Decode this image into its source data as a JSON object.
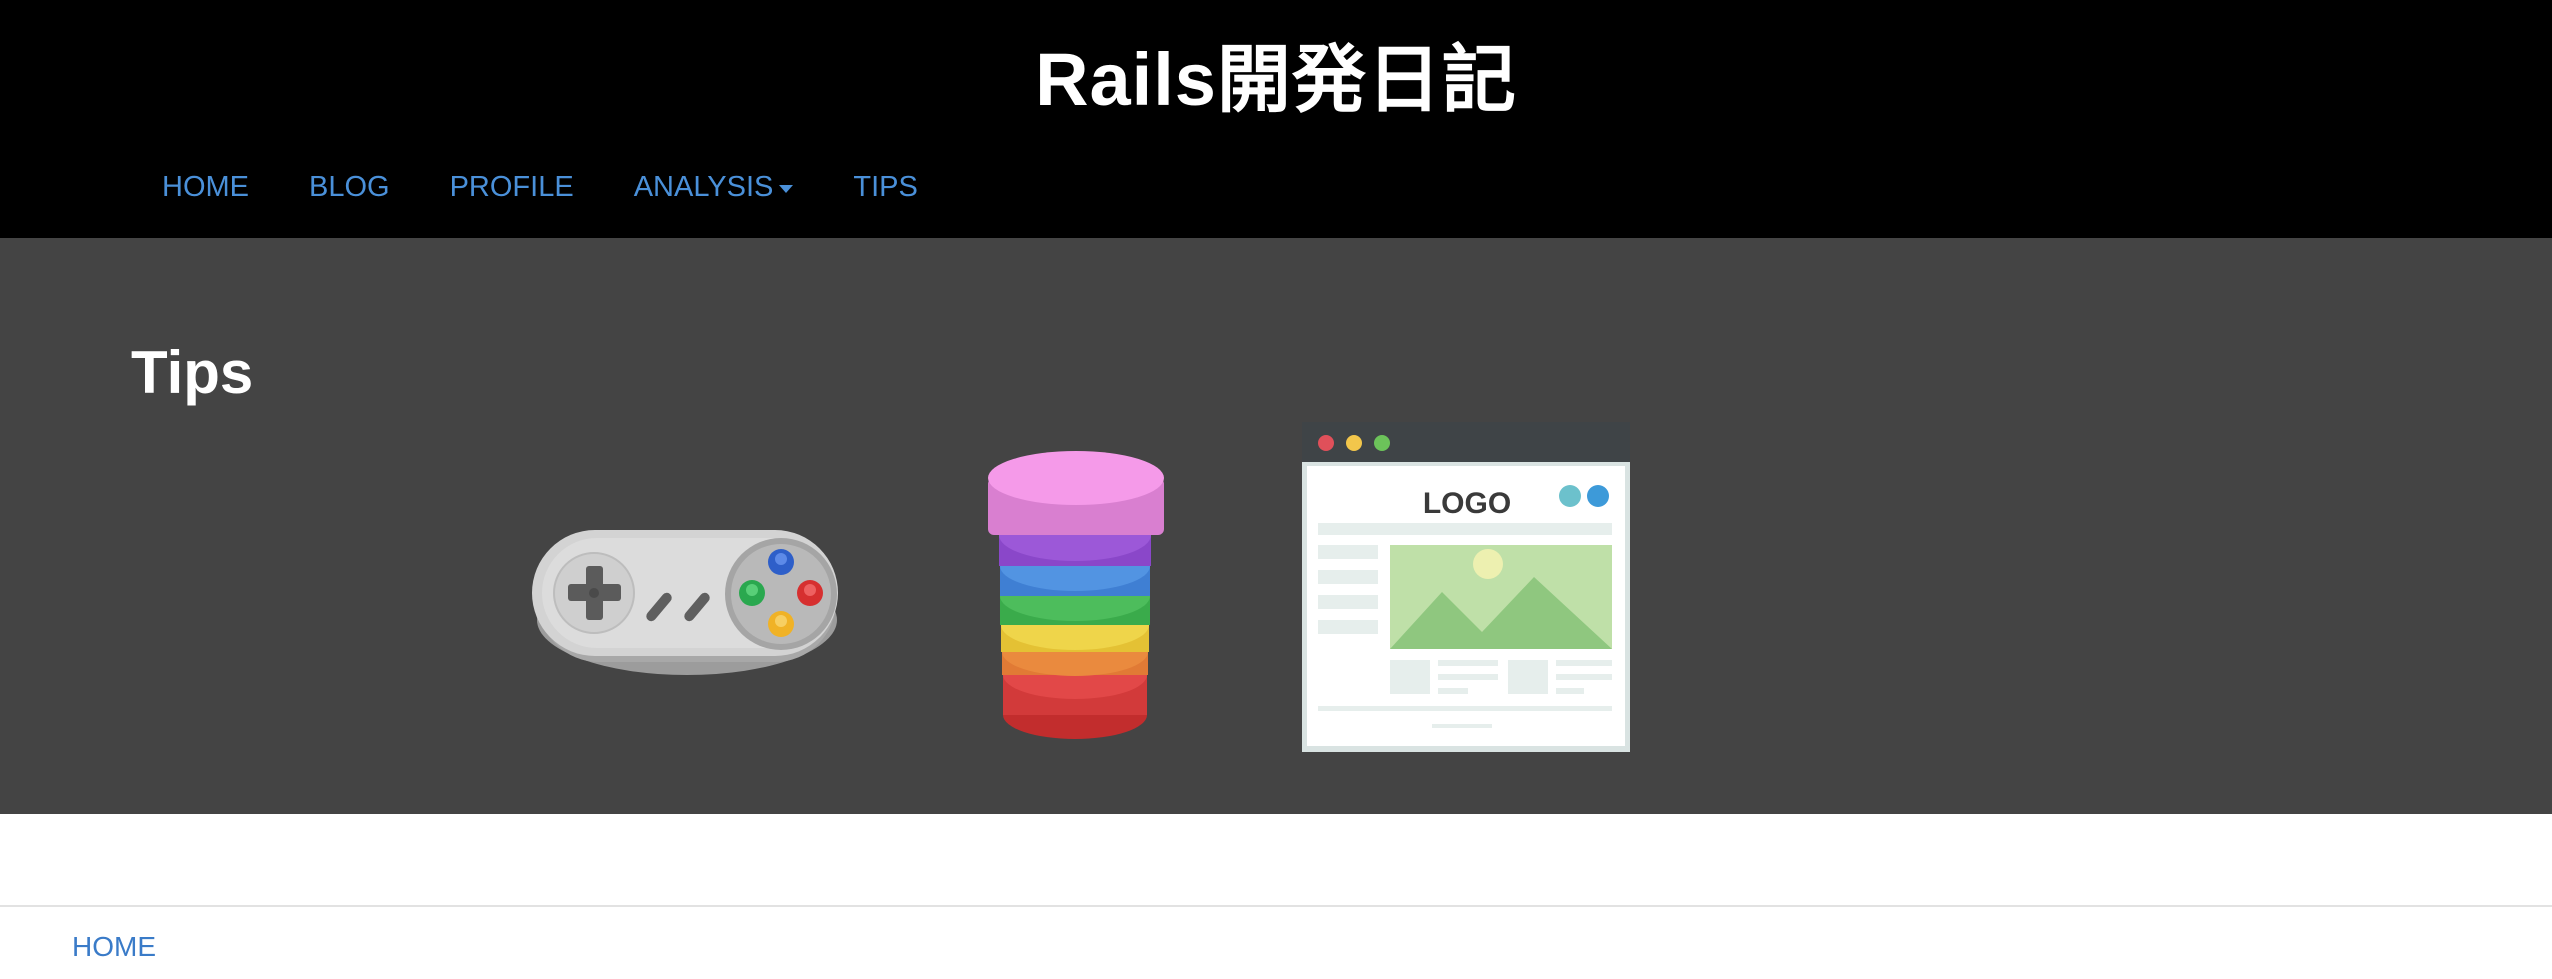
{
  "header": {
    "site_title": "Rails開発日記"
  },
  "nav": {
    "items": [
      {
        "label": "HOME"
      },
      {
        "label": "BLOG"
      },
      {
        "label": "PROFILE"
      },
      {
        "label": "ANALYSIS",
        "has_dropdown": true
      },
      {
        "label": "TIPS"
      }
    ]
  },
  "hero": {
    "title": "Tips",
    "illustrations": [
      {
        "icon": "game-controller-icon"
      },
      {
        "icon": "rainbow-database-stack-icon"
      },
      {
        "icon": "website-mockup-icon",
        "text": "LOGO"
      }
    ]
  },
  "breadcrumb": {
    "home_label": "HOME"
  },
  "colors": {
    "header_bg": "#000000",
    "hero_bg": "#444444",
    "link": "#4a90d9"
  }
}
